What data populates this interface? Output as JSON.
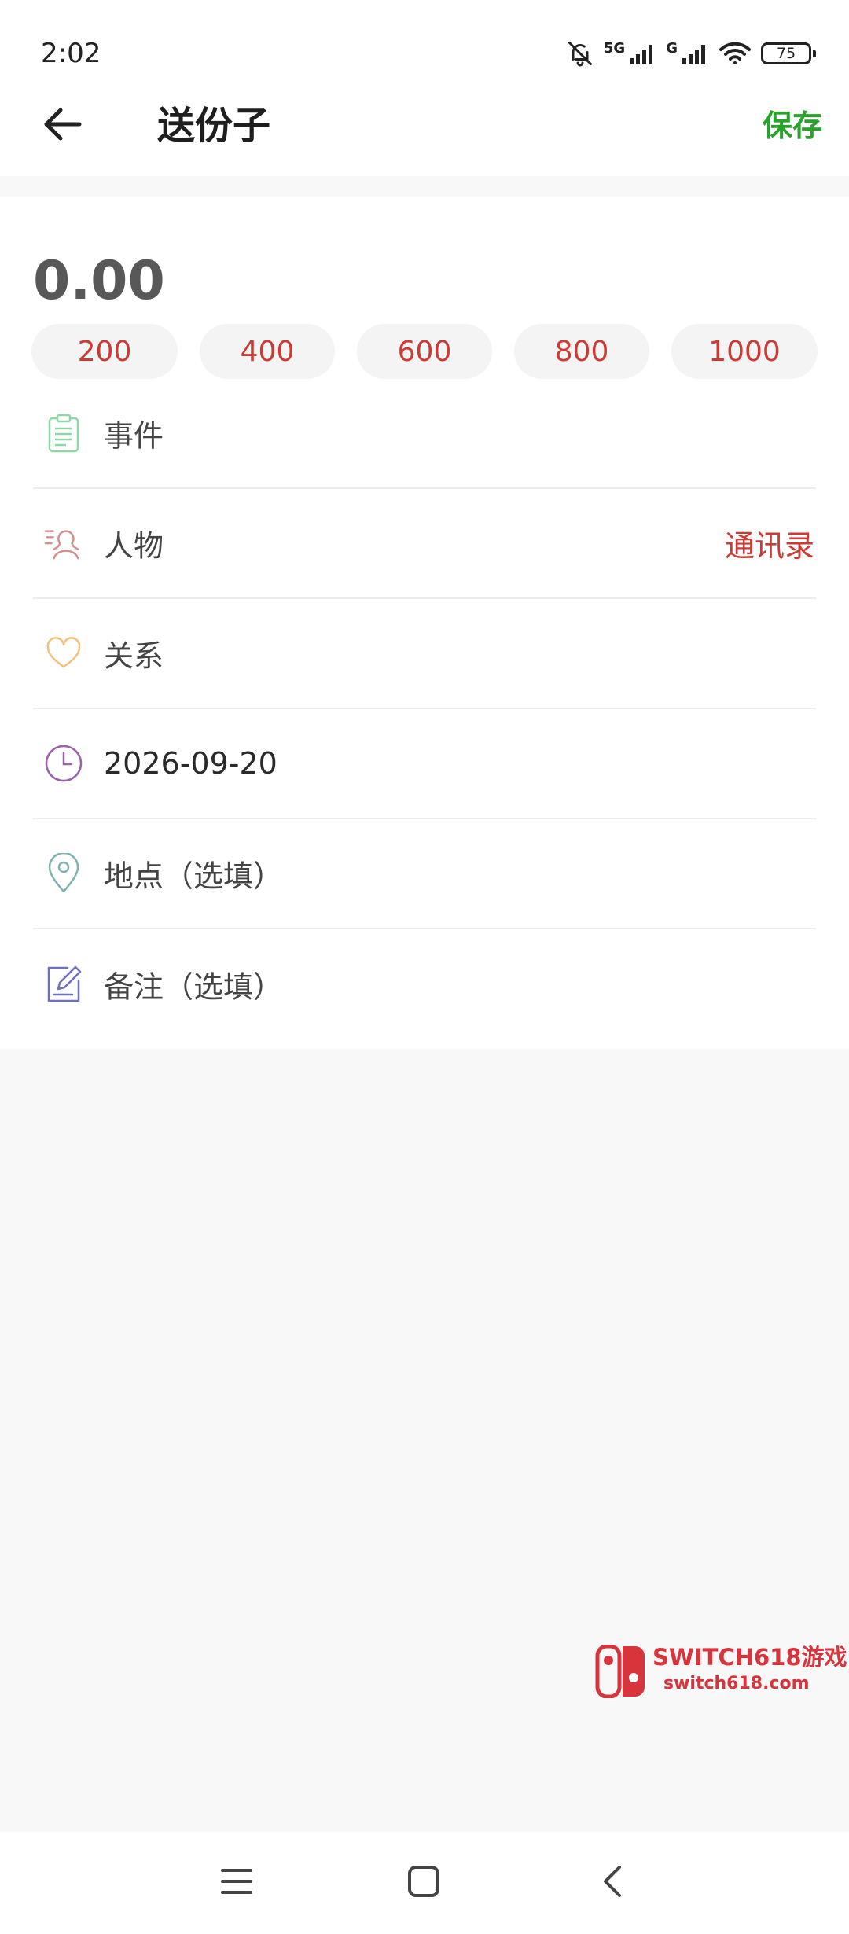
{
  "status_bar": {
    "time": "2:02",
    "signal_1_label": "5G",
    "signal_2_label": "G",
    "battery_level": "75"
  },
  "header": {
    "title": "送份子",
    "save_label": "保存"
  },
  "form": {
    "amount": "0.00",
    "quick_amounts": [
      "200",
      "400",
      "600",
      "800",
      "1000"
    ],
    "event_placeholder": "事件",
    "person_placeholder": "人物",
    "contacts_label": "通讯录",
    "relation_placeholder": "关系",
    "date_value": "2026-09-20",
    "location_placeholder": "地点（选填）",
    "note_placeholder": "备注（选填）"
  },
  "watermark": {
    "title": "SWITCH618游戏",
    "url": "switch618.com"
  },
  "colors": {
    "accent_green": "#2aa12a",
    "accent_red": "#cc3b33",
    "event_icon": "#8fd6a8",
    "person_icon": "#d98c8c",
    "relation_icon": "#f3c07a",
    "date_icon": "#9b62a8",
    "location_icon": "#7fb3b0",
    "note_icon": "#6f6fc0"
  },
  "icons": {
    "back": "arrow-left-icon",
    "event": "clipboard-icon",
    "person": "person-icon",
    "relation": "heart-icon",
    "date": "clock-icon",
    "location": "location-pin-icon",
    "note": "edit-note-icon"
  }
}
